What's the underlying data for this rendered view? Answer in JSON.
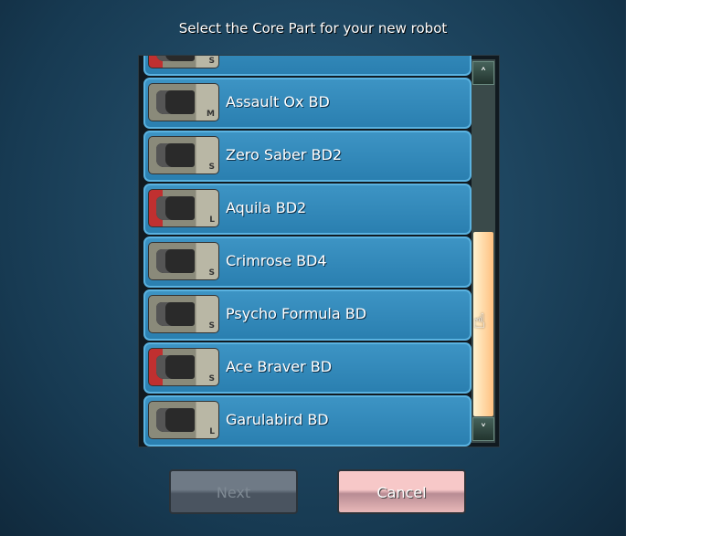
{
  "title": "Select the Core Part for your new robot",
  "parts": [
    {
      "name": "",
      "size": "S",
      "red": true
    },
    {
      "name": "Assault Ox BD",
      "size": "M",
      "red": false
    },
    {
      "name": "Zero Saber BD2",
      "size": "S",
      "red": false
    },
    {
      "name": "Aquila BD2",
      "size": "L",
      "red": true
    },
    {
      "name": "Crimrose BD4",
      "size": "S",
      "red": false
    },
    {
      "name": "Psycho Formula BD",
      "size": "S",
      "red": false
    },
    {
      "name": "Ace Braver BD",
      "size": "S",
      "red": true
    },
    {
      "name": "Garulabird BD",
      "size": "L",
      "red": false
    }
  ],
  "scroll": {
    "up": "˄",
    "down": "˅",
    "position_percent": 85
  },
  "buttons": {
    "next": "Next",
    "cancel": "Cancel"
  },
  "cursor": "☝"
}
